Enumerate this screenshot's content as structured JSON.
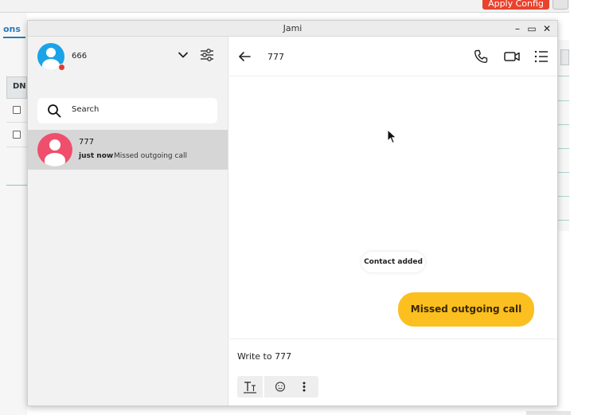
{
  "background_app": {
    "apply_button_label": "Apply Config",
    "tab_label": "ons",
    "column_header": "DN"
  },
  "window": {
    "title": "Jami",
    "controls": {
      "minimize": "–",
      "maximize": "▭",
      "close": "✕"
    }
  },
  "account": {
    "name": "666",
    "avatar_color": "#1aa3e8",
    "status_color": "#e53935"
  },
  "search": {
    "placeholder": "Search"
  },
  "conversations": [
    {
      "name": "777",
      "time": "just now",
      "last_message": "Missed outgoing call",
      "avatar_color": "#ef4f6c"
    }
  ],
  "chat": {
    "title": "777",
    "contact_added_label": "Contact added",
    "messages": [
      {
        "text": "Missed outgoing call",
        "direction": "outgoing",
        "color": "#fbbf1f"
      }
    ],
    "composer_placeholder": "Write to 777"
  },
  "icons": {
    "header": [
      "back-arrow-icon",
      "phone-icon",
      "video-camera-icon",
      "list-icon"
    ],
    "toolbar": [
      "text-format-icon",
      "emoji-icon",
      "more-vertical-icon"
    ]
  }
}
